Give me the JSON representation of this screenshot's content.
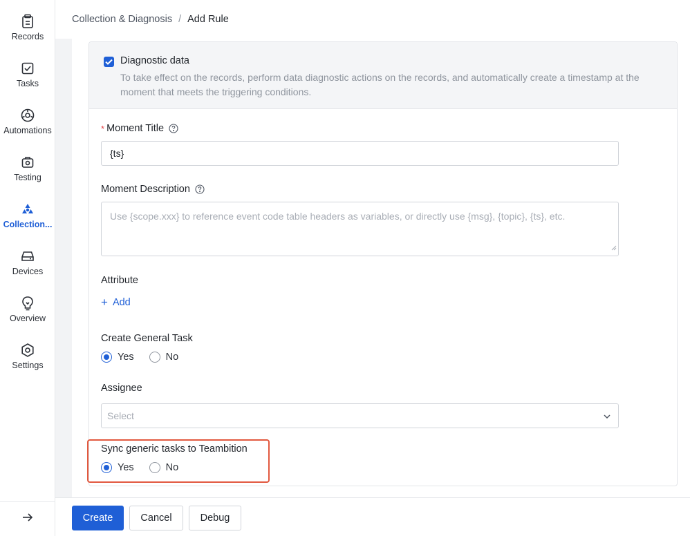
{
  "sidebar": {
    "items": [
      {
        "label": "Records",
        "icon": "records-icon"
      },
      {
        "label": "Tasks",
        "icon": "tasks-icon"
      },
      {
        "label": "Automations",
        "icon": "automations-icon"
      },
      {
        "label": "Testing",
        "icon": "testing-icon"
      },
      {
        "label": "Collection...",
        "icon": "collection-icon",
        "active": true
      },
      {
        "label": "Devices",
        "icon": "devices-icon"
      },
      {
        "label": "Overview",
        "icon": "overview-icon"
      },
      {
        "label": "Settings",
        "icon": "settings-icon"
      }
    ],
    "expand_icon": "arrow-right-icon"
  },
  "breadcrumb": {
    "parent": "Collection & Diagnosis",
    "separator": "/",
    "current": "Add Rule"
  },
  "diagnostic": {
    "checked": true,
    "title": "Diagnostic data",
    "description": "To take effect on the records, perform data diagnostic actions on the records, and automatically create a timestamp at the moment that meets the triggering conditions."
  },
  "form": {
    "moment_title": {
      "required_mark": "*",
      "label": "Moment Title",
      "value": "{ts}"
    },
    "moment_description": {
      "label": "Moment Description",
      "placeholder": "Use {scope.xxx} to reference event code table headers as variables, or directly use {msg}, {topic}, {ts}, etc."
    },
    "attribute": {
      "label": "Attribute",
      "add_label": "Add"
    },
    "create_general_task": {
      "label": "Create General Task",
      "options": [
        "Yes",
        "No"
      ],
      "selected": "Yes"
    },
    "assignee": {
      "label": "Assignee",
      "placeholder": "Select"
    },
    "sync_teambition": {
      "label": "Sync generic tasks to Teambition",
      "options": [
        "Yes",
        "No"
      ],
      "selected": "Yes"
    }
  },
  "footer": {
    "create_label": "Create",
    "cancel_label": "Cancel",
    "debug_label": "Debug"
  },
  "colors": {
    "accent": "#1f5fd6",
    "highlight_border": "#e2583e",
    "required": "#e5484d"
  }
}
